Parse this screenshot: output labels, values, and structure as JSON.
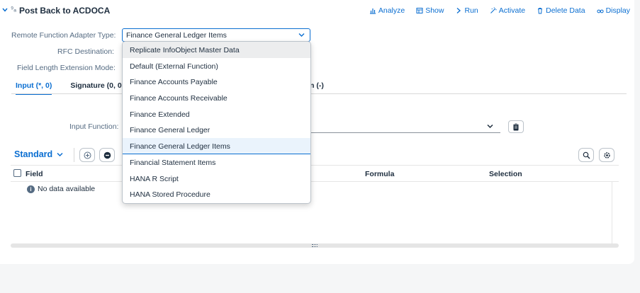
{
  "header": {
    "title": "Post Back to ACDOCA",
    "toolbar": [
      {
        "label": "Analyze",
        "icon": "bar-chart-icon"
      },
      {
        "label": "Show",
        "icon": "table-icon"
      },
      {
        "label": "Run",
        "icon": "chevron-right-icon"
      },
      {
        "label": "Activate",
        "icon": "activate-icon"
      },
      {
        "label": "Delete Data",
        "icon": "trash-icon"
      },
      {
        "label": "Display",
        "icon": "glasses-icon"
      }
    ]
  },
  "form": {
    "adapter_label": "Remote Function Adapter Type:",
    "adapter_value": "Finance General Ledger Items",
    "rfc_label": "RFC Destination:",
    "field_ext_label": "Field Length Extension Mode:"
  },
  "tabs": {
    "input": "Input (*, 0)",
    "signature": "Signature (0, 0",
    "rest": "n (-)"
  },
  "input_function": {
    "label": "Input Function:"
  },
  "variant": {
    "label": "Standard"
  },
  "table": {
    "columns": [
      "Field",
      "Formula",
      "Selection"
    ],
    "empty_text": "No data available"
  },
  "dropdown": {
    "options": [
      "Replicate InfoObject Master Data",
      "Default (External Function)",
      "Finance Accounts Payable",
      "Finance Accounts Receivable",
      "Finance Extended",
      "Finance General Ledger",
      "Finance General Ledger Items",
      "Financial Statement Items",
      "HANA R Script",
      "HANA Stored Procedure"
    ],
    "hover_index": 0,
    "selected_index": 6
  },
  "colors": {
    "accent": "#0a6ed1",
    "text": "#1d2d3e",
    "muted": "#556b82"
  }
}
